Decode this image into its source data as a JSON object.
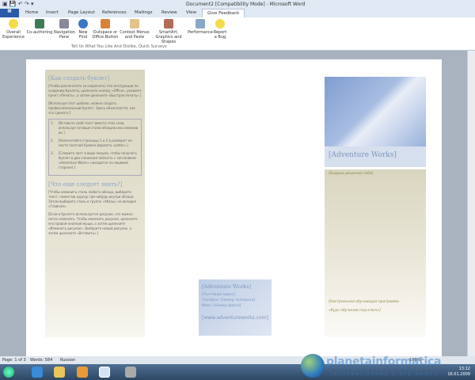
{
  "window": {
    "title": "Document2 [Compatibility Mode] - Microsoft Word"
  },
  "tabs": [
    "Home",
    "Insert",
    "Page Layout",
    "References",
    "Mailings",
    "Review",
    "View",
    "Give Feedback"
  ],
  "ribbon": {
    "buttons": [
      "Overall Experience",
      "Co-authoring",
      "Navigation Pane",
      "New Find",
      "Outspace or Office Button",
      "Context Menus and Paste",
      "SmartArt, Graphics and Shapes",
      "Performance",
      "Report a Bug"
    ],
    "group_label": "Tell Us What You Like And Dislike, Quick Surveys"
  },
  "left": {
    "h1": "[Как создать буклет]",
    "p1": "[Чтобы распечатать (и сохранить) эти инструкции по созданию буклета, щелкните кнопку «Office», укажите пункт «Печать», а затем щелкните «Быстрая печать».]",
    "p2": "[Используя этот шаблон, можно создать профессиональный буклет. Здесь объясняется, как это сделать:]",
    "list": [
      {
        "n": "1.",
        "t": "[Вставьте свой текст вместо этих слов, используя готовые стили абзацев или изменив их.]"
      },
      {
        "n": "2.",
        "t": "[Напечатайте страницы 1 и 2 в разворот на листе плотной бумаги формата «Letter».]"
      },
      {
        "n": "3.",
        "t": "[Сложите лист в виде письма, чтобы получить буклет в два сложения (область с заголовком «Adventure Works» находится на лицевой стороне).]"
      }
    ],
    "h2": "[Что еще следует знать?]",
    "p3": "[Чтобы изменить стиль любого абзаца, выберите текст, поместив курсор где-нибудь внутри абзаца. Затем выберите стиль в группе «Абзац» на вкладке «Главная».",
    "p4": "[Если в буклете используется рисунок, его можно легко изменить. Чтобы изменить рисунок, щелкните его правой кнопкой мыши, а затем щелкните «Изменить рисунок». Выберите новый рисунок, а затем щелкните «Вставить».]"
  },
  "middle": {
    "company": "[Adventure Works]",
    "address": "[Почтовый адрес]",
    "phone": "Телефон: [Номер телефона]",
    "fax": "Факс: [Номер факса]",
    "url": "[www.adventureworks.com]"
  },
  "right": {
    "company": "[Adventure Works]",
    "subtitle": "[Бодрые решения себе]",
    "line1": "[Настроенная обучающая программа",
    "line2": "«Курс обучения под ключ»]"
  },
  "status": {
    "page": "Page: 1 of 3",
    "words": "Words: 584",
    "language": "Russian",
    "zoom": "100%"
  },
  "taskbar": {
    "time": "13:12",
    "date": "16.01.2009"
  },
  "watermark": {
    "line1": "planetainformatica",
    "line2": "INFORMATIZANDO O SEU MUNDO"
  }
}
